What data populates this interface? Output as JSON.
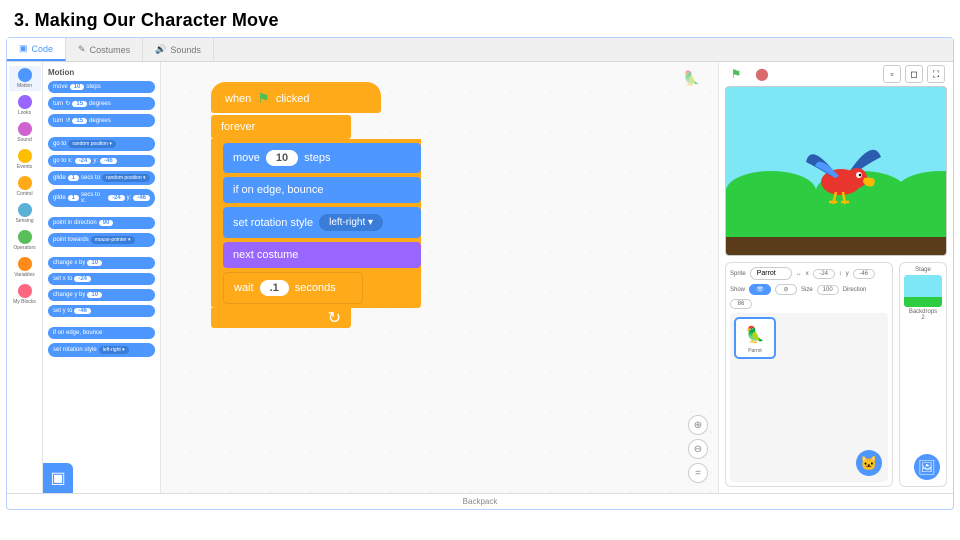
{
  "title": "3. Making Our Character Move",
  "tabs": {
    "code": "Code",
    "costumes": "Costumes",
    "sounds": "Sounds",
    "active": 0
  },
  "categories": [
    {
      "name": "Motion",
      "color": "#4d97ff",
      "active": true
    },
    {
      "name": "Looks",
      "color": "#9966ff"
    },
    {
      "name": "Sound",
      "color": "#cf63cf"
    },
    {
      "name": "Events",
      "color": "#ffbf00"
    },
    {
      "name": "Control",
      "color": "#ffab19"
    },
    {
      "name": "Sensing",
      "color": "#5cb1d6"
    },
    {
      "name": "Operators",
      "color": "#59c059"
    },
    {
      "name": "Variables",
      "color": "#ff8c1a"
    },
    {
      "name": "My Blocks",
      "color": "#ff6680"
    }
  ],
  "palette": {
    "header": "Motion",
    "blocks": {
      "move": {
        "t": "move",
        "v": "10",
        "s": "steps"
      },
      "turncw": {
        "t": "turn",
        "icon": "↻",
        "v": "15",
        "s": "degrees"
      },
      "turnccw": {
        "t": "turn",
        "icon": "↺",
        "v": "15",
        "s": "degrees"
      },
      "goto": {
        "t": "go to",
        "dd": "random position ▾"
      },
      "gotoxy": {
        "t": "go to x:",
        "v1": "-24",
        "m": "y:",
        "v2": "-46"
      },
      "gliderand": {
        "t": "glide",
        "v": "1",
        "m": "secs to",
        "dd": "random position ▾"
      },
      "glidexy": {
        "t": "glide",
        "v": "1",
        "m": "secs to x:",
        "v1": "-24",
        "m2": "y:",
        "v2": "-46"
      },
      "pointdir": {
        "t": "point in direction",
        "v": "90"
      },
      "pointtow": {
        "t": "point towards",
        "dd": "mouse-pointer ▾"
      },
      "changex": {
        "t": "change x by",
        "v": "10"
      },
      "setx": {
        "t": "set x to",
        "v": "-24"
      },
      "changey": {
        "t": "change y by",
        "v": "10"
      },
      "sety": {
        "t": "set y to",
        "v": "-46"
      },
      "edgebounce": {
        "t": "if on edge, bounce"
      },
      "rotstyle": {
        "t": "set rotation style",
        "dd": "left-right ▾"
      }
    }
  },
  "script": {
    "hat": {
      "t1": "when",
      "t2": "clicked",
      "flag": "⚑"
    },
    "forever": "forever",
    "move": {
      "t": "move",
      "v": "10",
      "s": "steps"
    },
    "edge": "if on edge, bounce",
    "rot": {
      "t": "set rotation style",
      "dd": "left-right ▾"
    },
    "next": "next costume",
    "wait": {
      "t": "wait",
      "v": ".1",
      "s": "seconds"
    },
    "loopicon": "↻"
  },
  "stage_controls": {
    "go": "⚑",
    "stop": "⬤"
  },
  "sprite_info": {
    "label_sprite": "Sprite",
    "name": "Parrot",
    "label_x": "x",
    "x": "-24",
    "label_y": "y",
    "y": "-46",
    "label_show": "Show",
    "label_size": "Size",
    "size": "100",
    "label_dir": "Direction",
    "dir": "86"
  },
  "sprite_thumb": {
    "name": "Parrot"
  },
  "stage_panel": {
    "label": "Stage",
    "backdrops_label": "Backdrops",
    "backdrops": "2"
  },
  "backpack": "Backpack"
}
